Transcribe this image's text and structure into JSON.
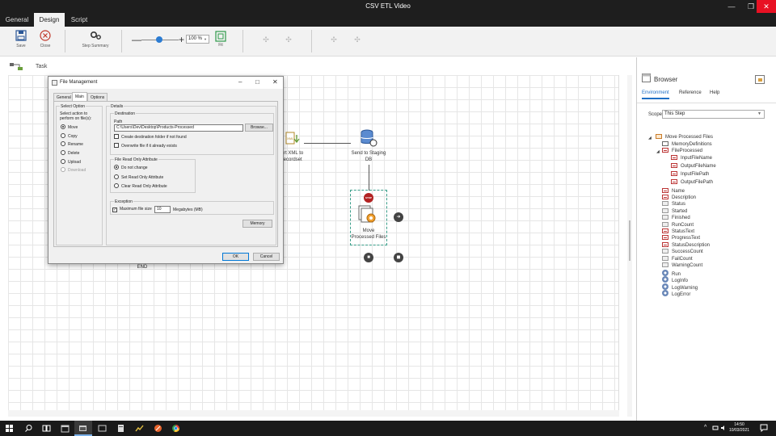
{
  "window": {
    "title": "CSV ETL Video",
    "min_glyph": "—",
    "max_glyph": "❐",
    "close_glyph": "✕"
  },
  "menu": {
    "tabs": [
      "General",
      "Design",
      "Script"
    ]
  },
  "ribbon": {
    "save_label": "Save",
    "close_label": "Close",
    "step_summary_label": "Step Summary",
    "zoom_value": "100 %",
    "fit_label": "Fit",
    "zoom_minus": "—",
    "zoom_plus": "+"
  },
  "task": {
    "label": "Task"
  },
  "flow": {
    "node_convert_label": "vert XML to\nRecordset",
    "node_staging_label": "Send to Staging\nDB",
    "node_move_label": "Move\nProcessed Files",
    "end_label": "END",
    "stop_badge": "STOP",
    "arrow_glyph": "➜"
  },
  "dialog": {
    "title": "File Management",
    "tabs": [
      "General",
      "Main",
      "Options"
    ],
    "select_option": {
      "title": "Select Option",
      "prompt": "Select action to perform on file(s):",
      "options": [
        "Move",
        "Copy",
        "Rename",
        "Delete",
        "Upload",
        "Download"
      ]
    },
    "details_title": "Details",
    "destination": {
      "title": "Destination",
      "path_label": "Path",
      "path_value": "C:\\Users\\Dev\\Desktop\\Products-Processed",
      "browse_label": "Browse...",
      "create_folder_label": "Create destination folder if not found",
      "overwrite_label": "Overwrite file if it already exists"
    },
    "read_only": {
      "title": "File Read Only Attribute",
      "options": [
        "Do not change",
        "Set Read Only Attribute",
        "Clear Read Only Attribute"
      ]
    },
    "exception": {
      "title": "Exception",
      "max_size_label": "Maximum file size",
      "max_size_value": "10",
      "unit_label": "Megabytes (MB)"
    },
    "memory_label": "Memory",
    "ok_label": "OK",
    "cancel_label": "Cancel"
  },
  "browser": {
    "title": "Browser",
    "tabs": [
      "Environment",
      "Reference",
      "Help"
    ],
    "scope_label": "Scope",
    "scope_value": "This Step",
    "tree": {
      "root": "Move Processed Files",
      "memory_definitions": "MemoryDefinitions",
      "file_processed": "FileProcessed",
      "file_processed_children": [
        "InputFileName",
        "OutputFileName",
        "InputFilePath",
        "OutputFilePath"
      ],
      "properties": [
        "Name",
        "Description",
        "Status",
        "Started",
        "Finished",
        "RunCount",
        "StatusText",
        "ProgressText",
        "StatusDescription",
        "SuccessCount",
        "FailCount",
        "WarningCount"
      ],
      "methods": [
        "Run",
        "LogInfo",
        "LogWarning",
        "LogError"
      ]
    }
  },
  "taskbar": {
    "time": "14:50",
    "date": "10/03/2021"
  }
}
